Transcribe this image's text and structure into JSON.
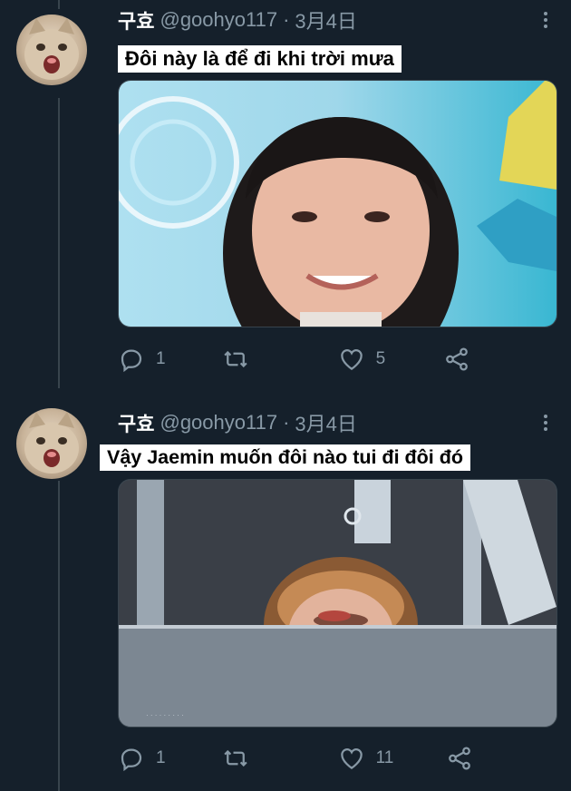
{
  "tweets": [
    {
      "author_name": "구효",
      "handle": "@goohyo117",
      "separator": "·",
      "date": "3月4日",
      "caption": "Đôi này là để đi khi trời mưa",
      "replies": "1",
      "retweets": "",
      "likes": "5"
    },
    {
      "author_name": "구효",
      "handle": "@goohyo117",
      "separator": "·",
      "date": "3月4日",
      "caption": "Vậy Jaemin muốn đôi nào tui đi đôi đó",
      "replies": "1",
      "retweets": "",
      "likes": "11"
    }
  ],
  "icons": {
    "reply": "reply-icon",
    "retweet": "retweet-icon",
    "like": "heart-icon",
    "share": "share-icon",
    "more": "more-icon"
  },
  "colors": {
    "background": "#15202b",
    "secondary_text": "#8899a6",
    "divider": "#38444d"
  }
}
